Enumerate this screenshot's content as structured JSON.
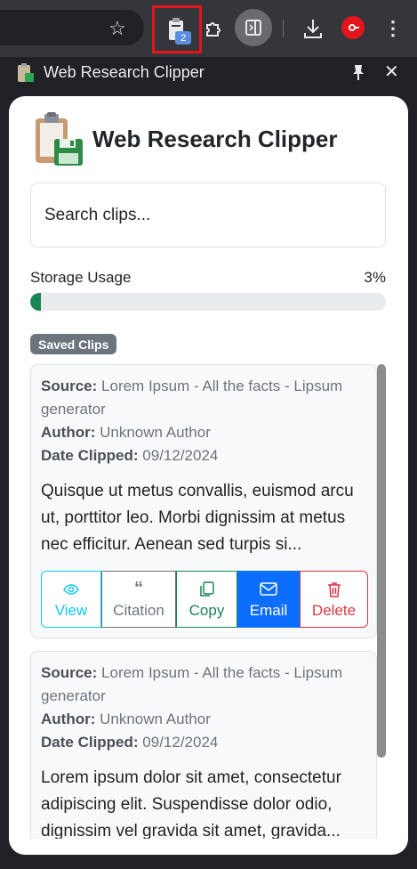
{
  "browser": {
    "extension_badge": "2",
    "side_panel_title": "Web Research Clipper"
  },
  "app": {
    "title": "Web Research Clipper"
  },
  "search": {
    "placeholder": "Search clips..."
  },
  "storage": {
    "label": "Storage Usage",
    "percent_text": "3%",
    "percent_value": 0.03
  },
  "saved_clips_label": "Saved Clips",
  "clips": [
    {
      "source_label": "Source:",
      "source": "Lorem Ipsum - All the facts - Lipsum generator",
      "author_label": "Author:",
      "author": "Unknown Author",
      "date_label": "Date Clipped:",
      "date": "09/12/2024",
      "excerpt": "Quisque ut metus convallis, euismod arcu ut, porttitor leo. Morbi dignissim at metus nec efficitur. Aenean sed turpis si..."
    },
    {
      "source_label": "Source:",
      "source": "Lorem Ipsum - All the facts - Lipsum generator",
      "author_label": "Author:",
      "author": "Unknown Author",
      "date_label": "Date Clipped:",
      "date": "09/12/2024",
      "excerpt": "Lorem ipsum dolor sit amet, consectetur adipiscing elit. Suspendisse dolor odio, dignissim vel gravida sit amet, gravida..."
    }
  ],
  "actions": {
    "view": "View",
    "citation": "Citation",
    "copy": "Copy",
    "email": "Email",
    "delete": "Delete"
  },
  "colors": {
    "view": "#0dcaf0",
    "citation": "#6c757d",
    "copy": "#198754",
    "email": "#0d6efd",
    "delete": "#dc3545",
    "progress": "#198754"
  }
}
